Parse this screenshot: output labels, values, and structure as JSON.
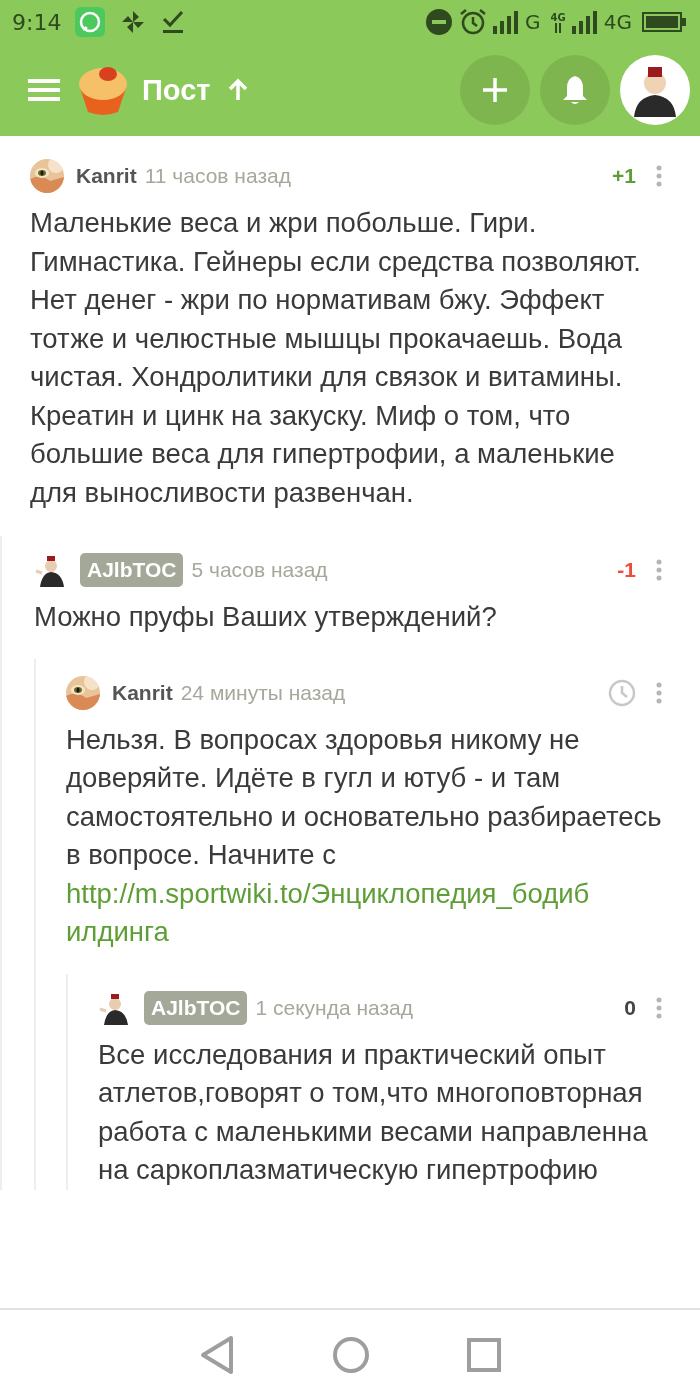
{
  "status_bar": {
    "time": "9:14",
    "network_1": "G",
    "network_2_small": "4G",
    "network_2": "4G"
  },
  "header": {
    "title": "Пост"
  },
  "comments": [
    {
      "author": "Kanrit",
      "own": false,
      "time": "11 часов назад",
      "rating": {
        "kind": "positive",
        "text": "+1"
      },
      "text": "Маленькие веса и жри побольше. Гири. Гимнастика. Гейнеры если средства позволяют. Нет денег - жри по нормативам бжу. Эффект тотже и челюстные мышцы прокачаешь. Вода чистая. Хондролитики для связок и витамины. Креатин и цинк на закуску. Миф о том, что большие веса для гипертрофии, а маленькие для выносливости развенчан.",
      "children": [
        {
          "author": "AJlbTOC",
          "own": true,
          "avatar": {
            "kind": "figure"
          },
          "time": "5 часов назад",
          "rating": {
            "kind": "negative",
            "text": "-1"
          },
          "text": "Можно пруфы Ваших утверждений?",
          "children": [
            {
              "author": "Kanrit",
              "own": false,
              "time": "24 минуты назад",
              "rating": {
                "kind": "pending"
              },
              "text": "Нельзя. В вопросах здоровья никому не доверяйте. Идёте в гугл и ютуб - и там самостоятельно и основательно разбираетесь в вопросе. Начните с",
              "link": "http://m.sportwiki.to/Энциклопедия_бодибилдинга",
              "children": [
                {
                  "author": "AJlbTOC",
                  "own": true,
                  "avatar": {
                    "kind": "figure"
                  },
                  "time": "1 секунда назад",
                  "rating": {
                    "kind": "neutral",
                    "text": "0"
                  },
                  "text": "Все исследования и практический опыт атлетов,говорят о том,что многоповторная работа с маленькими весами направленна на саркоплазматическую гипертрофию"
                }
              ]
            }
          ]
        }
      ]
    }
  ]
}
